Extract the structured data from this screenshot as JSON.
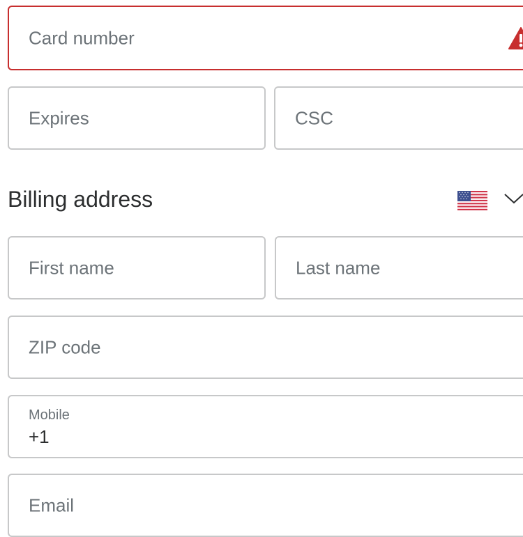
{
  "card": {
    "number_placeholder": "Card number",
    "expires_placeholder": "Expires",
    "csc_placeholder": "CSC",
    "error_icon": "warning-icon",
    "error_color": "#c72e2e"
  },
  "billing": {
    "heading": "Billing address",
    "country_flag": "us-flag-icon",
    "first_name_placeholder": "First name",
    "last_name_placeholder": "Last name",
    "zip_placeholder": "ZIP code",
    "mobile_label": "Mobile",
    "mobile_value": "+1",
    "email_placeholder": "Email"
  },
  "colors": {
    "border": "#c7c8c9",
    "placeholder_text": "#6c7378",
    "text": "#2c2e2f"
  }
}
